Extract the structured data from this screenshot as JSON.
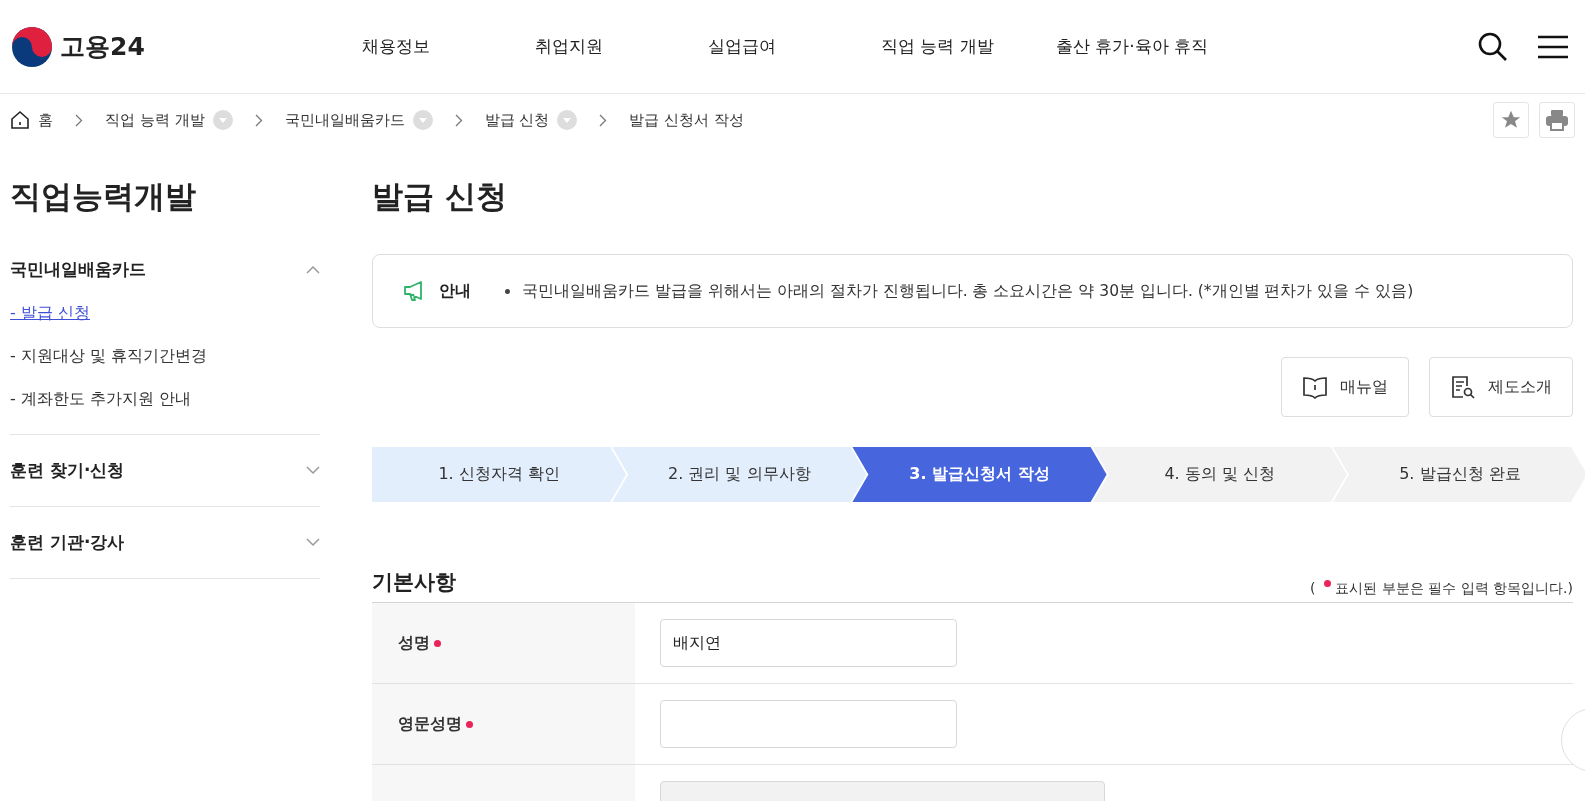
{
  "header": {
    "logo_text": "고용24",
    "nav": [
      "채용정보",
      "취업지원",
      "실업급여",
      "직업 능력 개발",
      "출산 휴가·육아 휴직"
    ]
  },
  "breadcrumb": [
    {
      "label": "홈",
      "kind": "home"
    },
    {
      "label": "직업 능력 개발",
      "kind": "dropdown"
    },
    {
      "label": "국민내일배움카드",
      "kind": "dropdown"
    },
    {
      "label": "발급 신청",
      "kind": "dropdown"
    },
    {
      "label": "발급 신청서 작성",
      "kind": "plain"
    }
  ],
  "sidebar": {
    "title": "직업능력개발",
    "groups": [
      {
        "title": "국민내일배움카드",
        "expanded": true,
        "children": [
          {
            "label": "- 발급 신청",
            "selected": true
          },
          {
            "label": "- 지원대상 및 휴직기간변경",
            "selected": false
          },
          {
            "label": "- 계좌한도 추가지원 안내",
            "selected": false
          }
        ]
      },
      {
        "title": "훈련 찾기·신청",
        "expanded": false
      },
      {
        "title": "훈련 기관·강사",
        "expanded": false
      }
    ]
  },
  "page_title": "발급 신청",
  "notice": {
    "label": "안내",
    "text": "국민내일배움카드 발급을 위해서는 아래의 절차가 진행됩니다. 총 소요시간은 약 30분 입니다. (*개인별 편차가 있을 수 있음)"
  },
  "actions": [
    {
      "label": "매뉴얼",
      "kind": "manual"
    },
    {
      "label": "제도소개",
      "kind": "intro"
    }
  ],
  "steps": [
    {
      "label": "1. 신청자격 확인",
      "selected": false,
      "completed": true
    },
    {
      "label": "2. 권리 및 의무사항",
      "selected": false,
      "completed": true
    },
    {
      "label": "3. 발급신청서 작성",
      "selected": true
    },
    {
      "label": "4. 동의 및 신청",
      "selected": false,
      "completed": false
    },
    {
      "label": "5. 발급신청 완료",
      "selected": false,
      "completed": false
    }
  ],
  "section": {
    "title": "기본사항",
    "required_note_open": "(",
    "required_note": "표시된 부분은 필수 입력 항목입니다.)",
    "fields": [
      {
        "label": "성명",
        "required": true,
        "value": "배지연",
        "disabled": false
      },
      {
        "label": "영문성명",
        "required": true,
        "disabled": false
      },
      {
        "disabled": true
      }
    ]
  }
}
